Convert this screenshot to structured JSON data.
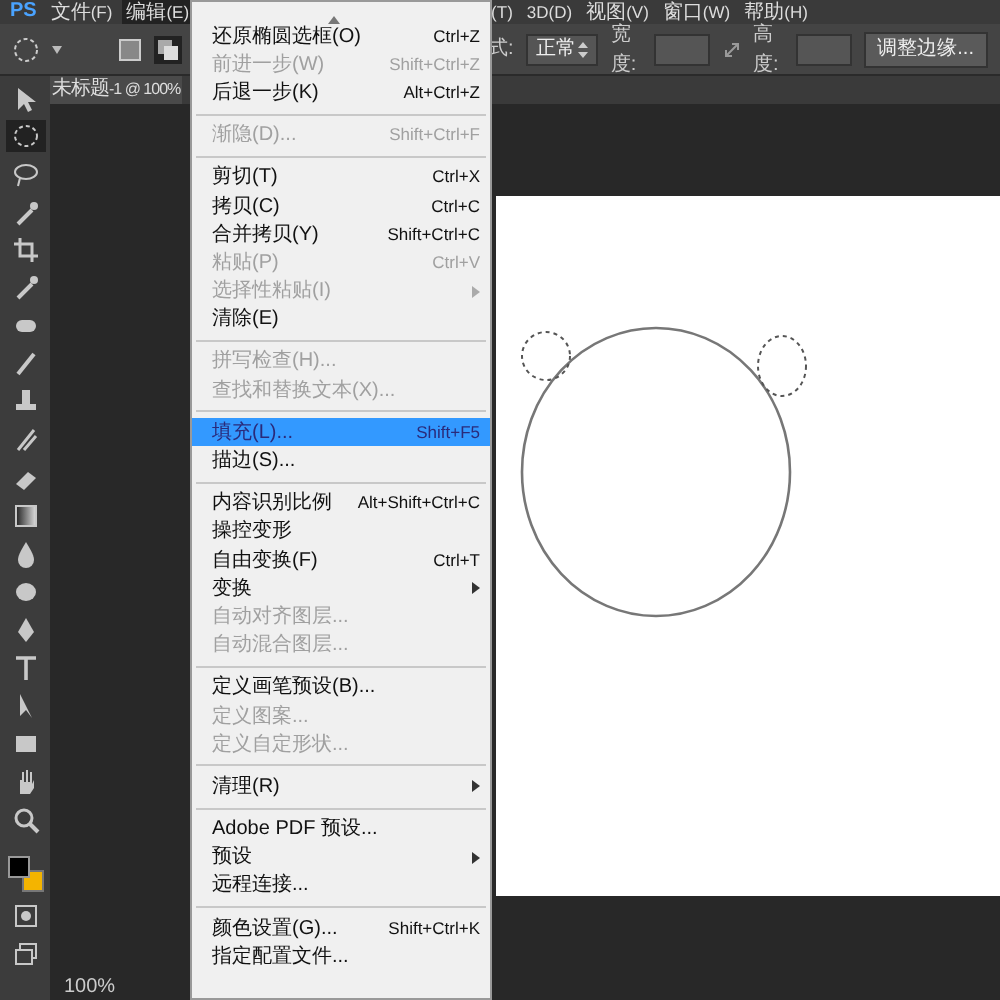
{
  "menubar": {
    "logo": "PS",
    "items": [
      {
        "label": "文件(F)",
        "selected": false
      },
      {
        "label": "编辑(E)",
        "selected": true
      }
    ],
    "items_right": [
      {
        "label": "(T)",
        "selected": false
      },
      {
        "label": "3D(D)",
        "selected": false
      },
      {
        "label": "视图(V)",
        "selected": false
      },
      {
        "label": "窗口(W)",
        "selected": false
      },
      {
        "label": "帮助(H)",
        "selected": false
      }
    ]
  },
  "options_bar": {
    "style_label": "式:",
    "style_value": "正常",
    "width_label": "宽度:",
    "height_label": "高度:",
    "refine_button": "调整边缘..."
  },
  "document_tab": {
    "title": "未标题-1 @ 100%"
  },
  "tools": [
    {
      "kind": "move",
      "selected": false
    },
    {
      "kind": "marquee",
      "selected": true
    },
    {
      "kind": "lasso",
      "selected": false
    },
    {
      "kind": "wand",
      "selected": false
    },
    {
      "kind": "crop",
      "selected": false
    },
    {
      "kind": "eyedropper",
      "selected": false
    },
    {
      "kind": "healing",
      "selected": false
    },
    {
      "kind": "brush",
      "selected": false
    },
    {
      "kind": "stamp",
      "selected": false
    },
    {
      "kind": "history",
      "selected": false
    },
    {
      "kind": "eraser",
      "selected": false
    },
    {
      "kind": "gradient",
      "selected": false
    },
    {
      "kind": "blur",
      "selected": false
    },
    {
      "kind": "dodge",
      "selected": false
    },
    {
      "kind": "pen",
      "selected": false
    },
    {
      "kind": "type",
      "selected": false
    },
    {
      "kind": "select",
      "selected": false
    },
    {
      "kind": "shape",
      "selected": false
    },
    {
      "kind": "hand",
      "selected": false
    },
    {
      "kind": "zoom",
      "selected": false
    }
  ],
  "status_bar": {
    "zoom": "100%"
  },
  "edit_menu": [
    {
      "kind": "item",
      "label": "还原椭圆选框(O)",
      "shortcut": "Ctrl+Z",
      "disabled": false,
      "selected": false,
      "submenu": false
    },
    {
      "kind": "item",
      "label": "前进一步(W)",
      "shortcut": "Shift+Ctrl+Z",
      "disabled": true,
      "selected": false,
      "submenu": false
    },
    {
      "kind": "item",
      "label": "后退一步(K)",
      "shortcut": "Alt+Ctrl+Z",
      "disabled": false,
      "selected": false,
      "submenu": false
    },
    {
      "kind": "separator"
    },
    {
      "kind": "item",
      "label": "渐隐(D)...",
      "shortcut": "Shift+Ctrl+F",
      "disabled": true,
      "selected": false,
      "submenu": false
    },
    {
      "kind": "separator"
    },
    {
      "kind": "item",
      "label": "剪切(T)",
      "shortcut": "Ctrl+X",
      "disabled": false,
      "selected": false,
      "submenu": false
    },
    {
      "kind": "item",
      "label": "拷贝(C)",
      "shortcut": "Ctrl+C",
      "disabled": false,
      "selected": false,
      "submenu": false
    },
    {
      "kind": "item",
      "label": "合并拷贝(Y)",
      "shortcut": "Shift+Ctrl+C",
      "disabled": false,
      "selected": false,
      "submenu": false
    },
    {
      "kind": "item",
      "label": "粘贴(P)",
      "shortcut": "Ctrl+V",
      "disabled": true,
      "selected": false,
      "submenu": false
    },
    {
      "kind": "item",
      "label": "选择性粘贴(I)",
      "disabled": true,
      "selected": false,
      "submenu": true
    },
    {
      "kind": "item",
      "label": "清除(E)",
      "disabled": false,
      "selected": false,
      "submenu": false
    },
    {
      "kind": "separator"
    },
    {
      "kind": "item",
      "label": "拼写检查(H)...",
      "disabled": true,
      "selected": false,
      "submenu": false
    },
    {
      "kind": "item",
      "label": "查找和替换文本(X)...",
      "disabled": true,
      "selected": false,
      "submenu": false
    },
    {
      "kind": "separator"
    },
    {
      "kind": "item",
      "label": "填充(L)...",
      "shortcut": "Shift+F5",
      "disabled": false,
      "selected": true,
      "submenu": false
    },
    {
      "kind": "item",
      "label": "描边(S)...",
      "disabled": false,
      "selected": false,
      "submenu": false
    },
    {
      "kind": "separator"
    },
    {
      "kind": "item",
      "label": "内容识别比例",
      "shortcut": "Alt+Shift+Ctrl+C",
      "disabled": false,
      "selected": false,
      "submenu": false
    },
    {
      "kind": "item",
      "label": "操控变形",
      "disabled": false,
      "selected": false,
      "submenu": false
    },
    {
      "kind": "item",
      "label": "自由变换(F)",
      "shortcut": "Ctrl+T",
      "disabled": false,
      "selected": false,
      "submenu": false
    },
    {
      "kind": "item",
      "label": "变换",
      "disabled": false,
      "selected": false,
      "submenu": true
    },
    {
      "kind": "item",
      "label": "自动对齐图层...",
      "disabled": true,
      "selected": false,
      "submenu": false
    },
    {
      "kind": "item",
      "label": "自动混合图层...",
      "disabled": true,
      "selected": false,
      "submenu": false
    },
    {
      "kind": "separator"
    },
    {
      "kind": "item",
      "label": "定义画笔预设(B)...",
      "disabled": false,
      "selected": false,
      "submenu": false
    },
    {
      "kind": "item",
      "label": "定义图案...",
      "disabled": true,
      "selected": false,
      "submenu": false
    },
    {
      "kind": "item",
      "label": "定义自定形状...",
      "disabled": true,
      "selected": false,
      "submenu": false
    },
    {
      "kind": "separator"
    },
    {
      "kind": "item",
      "label": "清理(R)",
      "disabled": false,
      "selected": false,
      "submenu": true
    },
    {
      "kind": "separator"
    },
    {
      "kind": "item",
      "label": "Adobe PDF 预设...",
      "disabled": false,
      "selected": false,
      "submenu": false
    },
    {
      "kind": "item",
      "label": "预设",
      "disabled": false,
      "selected": false,
      "submenu": true
    },
    {
      "kind": "item",
      "label": "远程连接...",
      "disabled": false,
      "selected": false,
      "submenu": false
    },
    {
      "kind": "separator"
    },
    {
      "kind": "item",
      "label": "颜色设置(G)...",
      "shortcut": "Shift+Ctrl+K",
      "disabled": false,
      "selected": false,
      "submenu": false
    },
    {
      "kind": "item",
      "label": "指定配置文件...",
      "disabled": false,
      "selected": false,
      "submenu": false
    }
  ]
}
